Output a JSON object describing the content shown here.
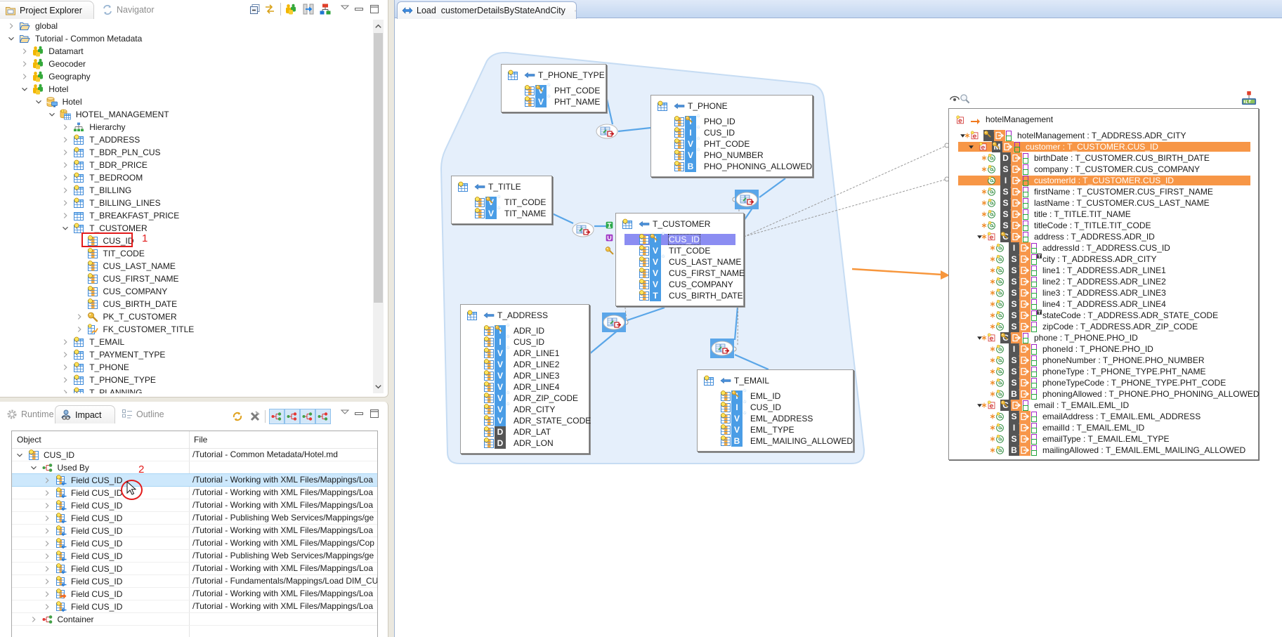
{
  "colors": {
    "mapping_orange": "#f7964a",
    "selection_orange": "#f79646",
    "selected_field": "#8b8df2",
    "type_badge_blue": "#4a9de6",
    "type_badge_dark": "#555555",
    "join_link": "#5aa6e8",
    "annotation_red": "#e21b1b",
    "selected_row": "#cde8fc"
  },
  "project_explorer": {
    "tabs": [
      {
        "label": "Project Explorer",
        "active": true,
        "closable": true
      },
      {
        "label": "Navigator",
        "active": false,
        "closable": false
      }
    ],
    "toolbar": [
      "collapse-all-icon",
      "link-with-editor-icon",
      "metadata-group-icon",
      "columns-view-icon",
      "hierarchy-view-icon",
      "view-menu-icon",
      "minimize-icon",
      "maximize-icon"
    ],
    "annotation": "1",
    "tree": [
      {
        "label": "global",
        "depth": 0,
        "state": "collapsed",
        "icon": "folder-icon"
      },
      {
        "label": "Tutorial - Common Metadata",
        "depth": 0,
        "state": "expanded",
        "icon": "folder-icon"
      },
      {
        "label": "Datamart",
        "depth": 1,
        "state": "collapsed",
        "icon": "metadata-model-icon"
      },
      {
        "label": "Geocoder",
        "depth": 1,
        "state": "collapsed",
        "icon": "metadata-model-icon"
      },
      {
        "label": "Geography",
        "depth": 1,
        "state": "collapsed",
        "icon": "metadata-model-icon"
      },
      {
        "label": "Hotel",
        "depth": 1,
        "state": "expanded",
        "icon": "metadata-model-icon"
      },
      {
        "label": "Hotel",
        "depth": 2,
        "state": "expanded",
        "icon": "database-icon"
      },
      {
        "label": "HOTEL_MANAGEMENT",
        "depth": 3,
        "state": "expanded",
        "icon": "schema-icon"
      },
      {
        "label": "Hierarchy",
        "depth": 4,
        "state": "collapsed",
        "icon": "hierarchy-icon"
      },
      {
        "label": "T_ADDRESS",
        "depth": 4,
        "state": "collapsed",
        "icon": "table-icon"
      },
      {
        "label": "T_BDR_PLN_CUS",
        "depth": 4,
        "state": "collapsed",
        "icon": "table-icon"
      },
      {
        "label": "T_BDR_PRICE",
        "depth": 4,
        "state": "collapsed",
        "icon": "table-icon"
      },
      {
        "label": "T_BEDROOM",
        "depth": 4,
        "state": "collapsed",
        "icon": "table-icon"
      },
      {
        "label": "T_BILLING",
        "depth": 4,
        "state": "collapsed",
        "icon": "table-icon"
      },
      {
        "label": "T_BILLING_LINES",
        "depth": 4,
        "state": "collapsed",
        "icon": "table-icon"
      },
      {
        "label": "T_BREAKFAST_PRICE",
        "depth": 4,
        "state": "collapsed",
        "icon": "table-plain-icon"
      },
      {
        "label": "T_CUSTOMER",
        "depth": 4,
        "state": "expanded",
        "icon": "table-icon"
      },
      {
        "label": "CUS_ID",
        "depth": 5,
        "state": "leaf",
        "icon": "column-icon",
        "annotated": true
      },
      {
        "label": "TIT_CODE",
        "depth": 5,
        "state": "leaf",
        "icon": "column-icon"
      },
      {
        "label": "CUS_LAST_NAME",
        "depth": 5,
        "state": "leaf",
        "icon": "column-icon"
      },
      {
        "label": "CUS_FIRST_NAME",
        "depth": 5,
        "state": "leaf",
        "icon": "column-icon"
      },
      {
        "label": "CUS_COMPANY",
        "depth": 5,
        "state": "leaf",
        "icon": "column-icon"
      },
      {
        "label": "CUS_BIRTH_DATE",
        "depth": 5,
        "state": "leaf",
        "icon": "column-icon"
      },
      {
        "label": "PK_T_CUSTOMER",
        "depth": 5,
        "state": "collapsed",
        "icon": "primary-key-icon"
      },
      {
        "label": "FK_CUSTOMER_TITLE",
        "depth": 5,
        "state": "collapsed",
        "icon": "foreign-key-icon"
      },
      {
        "label": "T_EMAIL",
        "depth": 4,
        "state": "collapsed",
        "icon": "table-icon"
      },
      {
        "label": "T_PAYMENT_TYPE",
        "depth": 4,
        "state": "collapsed",
        "icon": "table-icon"
      },
      {
        "label": "T_PHONE",
        "depth": 4,
        "state": "collapsed",
        "icon": "table-icon"
      },
      {
        "label": "T_PHONE_TYPE",
        "depth": 4,
        "state": "collapsed",
        "icon": "table-icon"
      },
      {
        "label": "T_PLANNING",
        "depth": 4,
        "state": "collapsed",
        "icon": "table-icon"
      }
    ]
  },
  "impact": {
    "tabs": [
      {
        "label": "Runtime",
        "active": false
      },
      {
        "label": "Impact",
        "active": true,
        "closable": true
      },
      {
        "label": "Outline",
        "active": false
      }
    ],
    "toolbar": [
      "refresh-icon",
      "remove-all-icon",
      "dependency-mode-1-icon",
      "dependency-mode-2-icon",
      "dependency-mode-3-icon",
      "dependency-mode-4-icon",
      "view-menu-icon",
      "minimize-icon",
      "maximize-icon"
    ],
    "columns": {
      "object": "Object",
      "file": "File"
    },
    "annotation": "2",
    "rows": [
      {
        "object": "CUS_ID",
        "file": "/Tutorial - Common Metadata/Hotel.md",
        "depth": 0,
        "state": "expanded",
        "icon": "column-icon"
      },
      {
        "object": "Used By",
        "file": "",
        "depth": 1,
        "state": "expanded",
        "icon": "used-by-icon"
      },
      {
        "object": "Field CUS_ID",
        "file": "/Tutorial - Working with XML Files/Mappings/Loa",
        "depth": 2,
        "state": "collapsed",
        "icon": "field-icon",
        "selected": true
      },
      {
        "object": "Field CUS_ID",
        "file": "/Tutorial - Working with XML Files/Mappings/Loa",
        "depth": 2,
        "state": "collapsed",
        "icon": "field-icon"
      },
      {
        "object": "Field CUS_ID",
        "file": "/Tutorial - Working with XML Files/Mappings/Loa",
        "depth": 2,
        "state": "collapsed",
        "icon": "field-icon"
      },
      {
        "object": "Field CUS_ID",
        "file": "/Tutorial - Publishing Web Services/Mappings/ge",
        "depth": 2,
        "state": "collapsed",
        "icon": "field-icon"
      },
      {
        "object": "Field CUS_ID",
        "file": "/Tutorial - Working with XML Files/Mappings/Loa",
        "depth": 2,
        "state": "collapsed",
        "icon": "field-icon"
      },
      {
        "object": "Field CUS_ID",
        "file": "/Tutorial - Working with XML Files/Mappings/Cop",
        "depth": 2,
        "state": "collapsed",
        "icon": "field-icon"
      },
      {
        "object": "Field CUS_ID",
        "file": "/Tutorial - Publishing Web Services/Mappings/ge",
        "depth": 2,
        "state": "collapsed",
        "icon": "field-icon"
      },
      {
        "object": "Field CUS_ID",
        "file": "/Tutorial - Working with XML Files/Mappings/Loa",
        "depth": 2,
        "state": "collapsed",
        "icon": "field-icon"
      },
      {
        "object": "Field CUS_ID",
        "file": "/Tutorial - Fundamentals/Mappings/Load DIM_CU",
        "depth": 2,
        "state": "collapsed",
        "icon": "field-icon"
      },
      {
        "object": "Field CUS_ID",
        "file": "/Tutorial - Working with XML Files/Mappings/Loa",
        "depth": 2,
        "state": "collapsed",
        "icon": "field-target-icon"
      },
      {
        "object": "Field CUS_ID",
        "file": "/Tutorial - Working with XML Files/Mappings/Loa",
        "depth": 2,
        "state": "collapsed",
        "icon": "field-icon"
      },
      {
        "object": "Container",
        "file": "",
        "depth": 1,
        "state": "collapsed",
        "icon": "container-icon"
      }
    ]
  },
  "editor": {
    "tab_label": "Load  customerDetailsByStateAndCity",
    "entities": [
      {
        "name": "T_PHONE_TYPE",
        "fields": [
          {
            "name": "PHT_CODE",
            "type": "V",
            "key": true,
            "required": true
          },
          {
            "name": "PHT_NAME",
            "type": "V",
            "required": true
          }
        ]
      },
      {
        "name": "T_PHONE",
        "fields": [
          {
            "name": "PHO_ID",
            "type": "I",
            "key": true,
            "required": true
          },
          {
            "name": "CUS_ID",
            "type": "I",
            "required": true
          },
          {
            "name": "PHT_CODE",
            "type": "V",
            "required": true
          },
          {
            "name": "PHO_NUMBER",
            "type": "V",
            "required": true
          },
          {
            "name": "PHO_PHONING_ALLOWED",
            "type": "B"
          }
        ]
      },
      {
        "name": "T_TITLE",
        "fields": [
          {
            "name": "TIT_CODE",
            "type": "V",
            "key": true,
            "required": true
          },
          {
            "name": "TIT_NAME",
            "type": "V",
            "required": true
          }
        ]
      },
      {
        "name": "T_CUSTOMER",
        "fields": [
          {
            "name": "CUS_ID",
            "type": "I",
            "key": true,
            "required": true,
            "selected": true
          },
          {
            "name": "TIT_CODE",
            "type": "V"
          },
          {
            "name": "CUS_LAST_NAME",
            "type": "V",
            "required": true
          },
          {
            "name": "CUS_FIRST_NAME",
            "type": "V"
          },
          {
            "name": "CUS_COMPANY",
            "type": "V"
          },
          {
            "name": "CUS_BIRTH_DATE",
            "type": "T"
          }
        ]
      },
      {
        "name": "T_ADDRESS",
        "fields": [
          {
            "name": "ADR_ID",
            "type": "I",
            "key": true,
            "required": true
          },
          {
            "name": "CUS_ID",
            "type": "I",
            "required": true
          },
          {
            "name": "ADR_LINE1",
            "type": "V",
            "required": true
          },
          {
            "name": "ADR_LINE2",
            "type": "V"
          },
          {
            "name": "ADR_LINE3",
            "type": "V"
          },
          {
            "name": "ADR_LINE4",
            "type": "V"
          },
          {
            "name": "ADR_ZIP_CODE",
            "type": "V",
            "required": true
          },
          {
            "name": "ADR_CITY",
            "type": "V",
            "required": true
          },
          {
            "name": "ADR_STATE_CODE",
            "type": "V"
          },
          {
            "name": "ADR_LAT",
            "type": "D"
          },
          {
            "name": "ADR_LON",
            "type": "D"
          }
        ]
      },
      {
        "name": "T_EMAIL",
        "fields": [
          {
            "name": "EML_ID",
            "type": "I",
            "key": true,
            "required": true
          },
          {
            "name": "CUS_ID",
            "type": "I",
            "required": true
          },
          {
            "name": "EML_ADDRESS",
            "type": "V",
            "required": true
          },
          {
            "name": "EML_TYPE",
            "type": "V"
          },
          {
            "name": "EML_MAILING_ALLOWED",
            "type": "B"
          }
        ]
      }
    ],
    "target": {
      "title": "hotelManagement",
      "rows": [
        {
          "label": "hotelManagement : T_ADDRESS.ADR_CITY",
          "depth": 0,
          "kind": "element",
          "type": "",
          "key": true,
          "marked": true,
          "expanded": true
        },
        {
          "label": "customer : T_CUSTOMER.CUS_ID",
          "depth": 1,
          "kind": "element",
          "type": "M",
          "key": true,
          "marked": false,
          "expanded": true,
          "highlighted": true
        },
        {
          "label": "birthDate : T_CUSTOMER.CUS_BIRTH_DATE",
          "depth": 2,
          "kind": "attribute",
          "type": "D",
          "marked": true
        },
        {
          "label": "company : T_CUSTOMER.CUS_COMPANY",
          "depth": 2,
          "kind": "attribute",
          "type": "S",
          "marked": true
        },
        {
          "label": "customerId : T_CUSTOMER.CUS_ID",
          "depth": 2,
          "kind": "attribute",
          "type": "I",
          "marked": false,
          "highlighted": true
        },
        {
          "label": "firstName : T_CUSTOMER.CUS_FIRST_NAME",
          "depth": 2,
          "kind": "attribute",
          "type": "S",
          "marked": true
        },
        {
          "label": "lastName : T_CUSTOMER.CUS_LAST_NAME",
          "depth": 2,
          "kind": "attribute",
          "type": "S",
          "marked": true
        },
        {
          "label": "title : T_TITLE.TIT_NAME",
          "depth": 2,
          "kind": "attribute",
          "type": "S",
          "marked": true
        },
        {
          "label": "titleCode : T_TITLE.TIT_CODE",
          "depth": 2,
          "kind": "attribute",
          "type": "S",
          "marked": true
        },
        {
          "label": "address : T_ADDRESS.ADR_ID",
          "depth": 2,
          "kind": "element",
          "type": "C",
          "key": true,
          "marked": true,
          "expanded": true
        },
        {
          "label": "addressId : T_ADDRESS.CUS_ID",
          "depth": 3,
          "kind": "attribute",
          "type": "I",
          "marked": true
        },
        {
          "label": "city : T_ADDRESS.ADR_CITY",
          "depth": 3,
          "kind": "attribute",
          "type": "S",
          "marked": true,
          "filter": true
        },
        {
          "label": "line1 : T_ADDRESS.ADR_LINE1",
          "depth": 3,
          "kind": "attribute",
          "type": "S",
          "marked": true
        },
        {
          "label": "line2 : T_ADDRESS.ADR_LINE2",
          "depth": 3,
          "kind": "attribute",
          "type": "S",
          "marked": true
        },
        {
          "label": "line3 : T_ADDRESS.ADR_LINE3",
          "depth": 3,
          "kind": "attribute",
          "type": "S",
          "marked": true
        },
        {
          "label": "line4 : T_ADDRESS.ADR_LINE4",
          "depth": 3,
          "kind": "attribute",
          "type": "S",
          "marked": true
        },
        {
          "label": "stateCode : T_ADDRESS.ADR_STATE_CODE",
          "depth": 3,
          "kind": "attribute",
          "type": "S",
          "marked": true,
          "filter": true
        },
        {
          "label": "zipCode : T_ADDRESS.ADR_ZIP_CODE",
          "depth": 3,
          "kind": "attribute",
          "type": "S",
          "marked": true
        },
        {
          "label": "phone : T_PHONE.PHO_ID",
          "depth": 2,
          "kind": "element",
          "type": "C",
          "key": true,
          "marked": true,
          "expanded": true
        },
        {
          "label": "phoneId : T_PHONE.PHO_ID",
          "depth": 3,
          "kind": "attribute",
          "type": "I",
          "marked": true
        },
        {
          "label": "phoneNumber : T_PHONE.PHO_NUMBER",
          "depth": 3,
          "kind": "attribute",
          "type": "S",
          "marked": true
        },
        {
          "label": "phoneType : T_PHONE_TYPE.PHT_NAME",
          "depth": 3,
          "kind": "attribute",
          "type": "S",
          "marked": true
        },
        {
          "label": "phoneTypeCode : T_PHONE_TYPE.PHT_CODE",
          "depth": 3,
          "kind": "attribute",
          "type": "S",
          "marked": true
        },
        {
          "label": "phoningAllowed : T_PHONE.PHO_PHONING_ALLOWED",
          "depth": 3,
          "kind": "attribute",
          "type": "B",
          "marked": true
        },
        {
          "label": "email : T_EMAIL.EML_ID",
          "depth": 2,
          "kind": "element",
          "type": "C",
          "key": true,
          "marked": true,
          "expanded": true
        },
        {
          "label": "emailAddress : T_EMAIL.EML_ADDRESS",
          "depth": 3,
          "kind": "attribute",
          "type": "S",
          "marked": true
        },
        {
          "label": "emailId : T_EMAIL.EML_ID",
          "depth": 3,
          "kind": "attribute",
          "type": "I",
          "marked": true
        },
        {
          "label": "emailType : T_EMAIL.EML_TYPE",
          "depth": 3,
          "kind": "attribute",
          "type": "S",
          "marked": true
        },
        {
          "label": "mailingAllowed : T_EMAIL.EML_MAILING_ALLOWED",
          "depth": 3,
          "kind": "attribute",
          "type": "B",
          "marked": true
        }
      ]
    }
  }
}
